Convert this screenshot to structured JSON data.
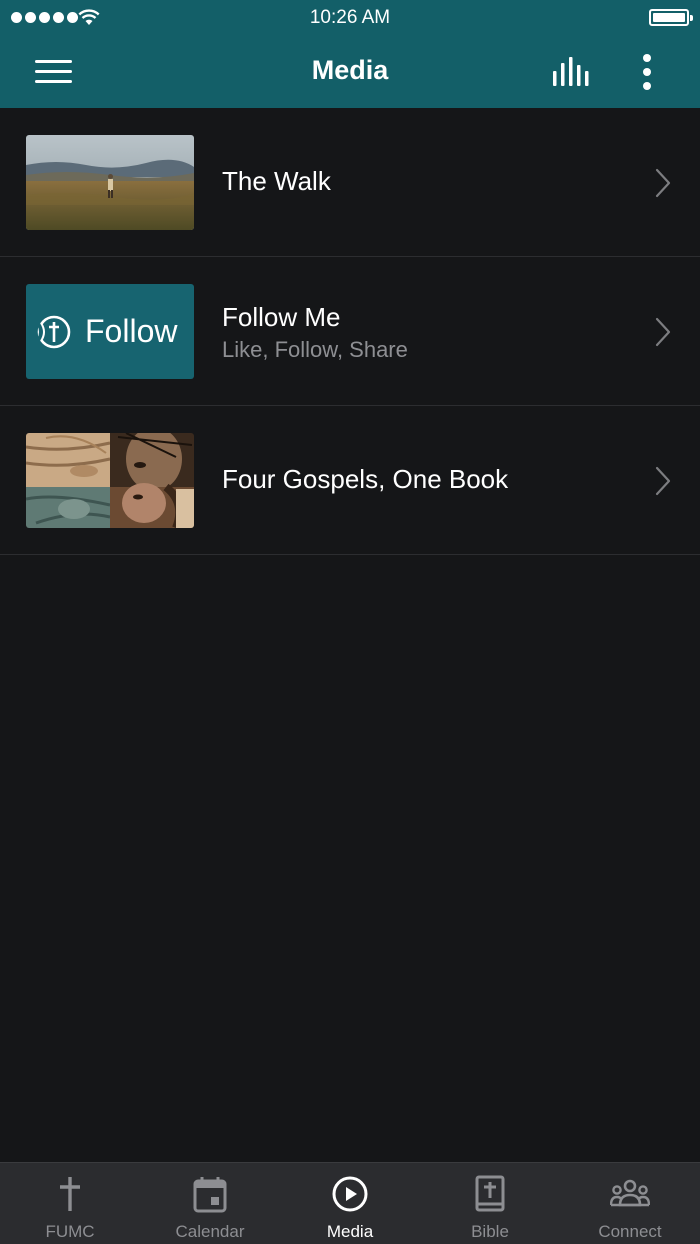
{
  "status_bar": {
    "time": "10:26 AM"
  },
  "nav": {
    "title": "Media",
    "menu_icon": "hamburger-menu-icon",
    "audio_icon": "audio-bars-icon",
    "more_icon": "vertical-ellipsis-icon"
  },
  "media_items": [
    {
      "title": "The Walk",
      "subtitle": ""
    },
    {
      "title": "Follow Me",
      "subtitle": "Like, Follow, Share",
      "thumb_text": "Follow"
    },
    {
      "title": "Four Gospels, One Book",
      "subtitle": ""
    }
  ],
  "tabs": [
    {
      "label": "FUMC",
      "icon": "cross-icon",
      "active": false
    },
    {
      "label": "Calendar",
      "icon": "calendar-icon",
      "active": false
    },
    {
      "label": "Media",
      "icon": "play-circle-icon",
      "active": true
    },
    {
      "label": "Bible",
      "icon": "bible-icon",
      "active": false
    },
    {
      "label": "Connect",
      "icon": "people-group-icon",
      "active": false
    }
  ],
  "colors": {
    "brand_teal": "#135f68",
    "background": "#151618",
    "tab_bar": "#2b2c2f",
    "inactive_tab": "#8d8e92",
    "subtitle": "#8e8f93"
  }
}
